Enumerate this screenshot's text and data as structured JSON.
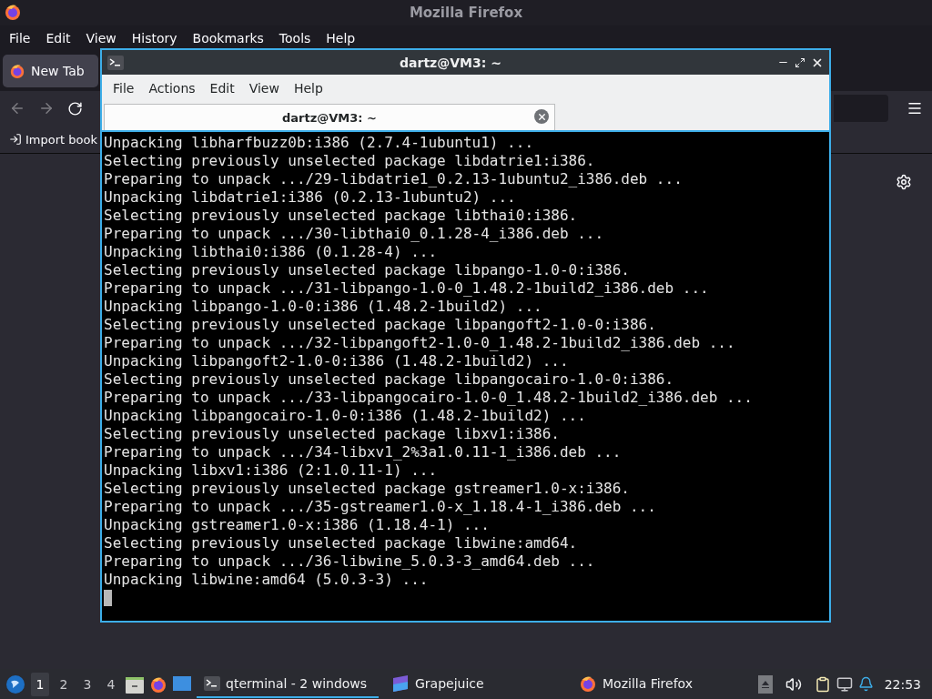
{
  "firefox": {
    "title": "Mozilla Firefox",
    "menu": [
      "File",
      "Edit",
      "View",
      "History",
      "Bookmarks",
      "Tools",
      "Help"
    ],
    "tabs": [
      {
        "label": "New Tab",
        "selected": true
      }
    ],
    "bookmarks": [
      "Import book"
    ]
  },
  "terminal": {
    "title": "dartz@VM3: ~",
    "menu": [
      "File",
      "Actions",
      "Edit",
      "View",
      "Help"
    ],
    "tabs": [
      {
        "label": "dartz@VM3: ~",
        "selected": true
      }
    ],
    "lines": [
      "Unpacking libharfbuzz0b:i386 (2.7.4-1ubuntu1) ...",
      "Selecting previously unselected package libdatrie1:i386.",
      "Preparing to unpack .../29-libdatrie1_0.2.13-1ubuntu2_i386.deb ...",
      "Unpacking libdatrie1:i386 (0.2.13-1ubuntu2) ...",
      "Selecting previously unselected package libthai0:i386.",
      "Preparing to unpack .../30-libthai0_0.1.28-4_i386.deb ...",
      "Unpacking libthai0:i386 (0.1.28-4) ...",
      "Selecting previously unselected package libpango-1.0-0:i386.",
      "Preparing to unpack .../31-libpango-1.0-0_1.48.2-1build2_i386.deb ...",
      "Unpacking libpango-1.0-0:i386 (1.48.2-1build2) ...",
      "Selecting previously unselected package libpangoft2-1.0-0:i386.",
      "Preparing to unpack .../32-libpangoft2-1.0-0_1.48.2-1build2_i386.deb ...",
      "Unpacking libpangoft2-1.0-0:i386 (1.48.2-1build2) ...",
      "Selecting previously unselected package libpangocairo-1.0-0:i386.",
      "Preparing to unpack .../33-libpangocairo-1.0-0_1.48.2-1build2_i386.deb ...",
      "Unpacking libpangocairo-1.0-0:i386 (1.48.2-1build2) ...",
      "Selecting previously unselected package libxv1:i386.",
      "Preparing to unpack .../34-libxv1_2%3a1.0.11-1_i386.deb ...",
      "Unpacking libxv1:i386 (2:1.0.11-1) ...",
      "Selecting previously unselected package gstreamer1.0-x:i386.",
      "Preparing to unpack .../35-gstreamer1.0-x_1.18.4-1_i386.deb ...",
      "Unpacking gstreamer1.0-x:i386 (1.18.4-1) ...",
      "Selecting previously unselected package libwine:amd64.",
      "Preparing to unpack .../36-libwine_5.0.3-3_amd64.deb ...",
      "Unpacking libwine:amd64 (5.0.3-3) ..."
    ]
  },
  "taskbar": {
    "workspaces": [
      {
        "label": "1",
        "selected": true
      },
      {
        "label": "2",
        "selected": false
      },
      {
        "label": "3",
        "selected": false
      },
      {
        "label": "4",
        "selected": false
      }
    ],
    "tasks": [
      {
        "kind": "terminal",
        "label": "qterminal - 2 windows",
        "selected": true
      },
      {
        "kind": "grapejuice",
        "label": "Grapejuice",
        "selected": false
      },
      {
        "kind": "firefox",
        "label": "Mozilla Firefox",
        "selected": false
      }
    ],
    "clock": "22:53"
  }
}
